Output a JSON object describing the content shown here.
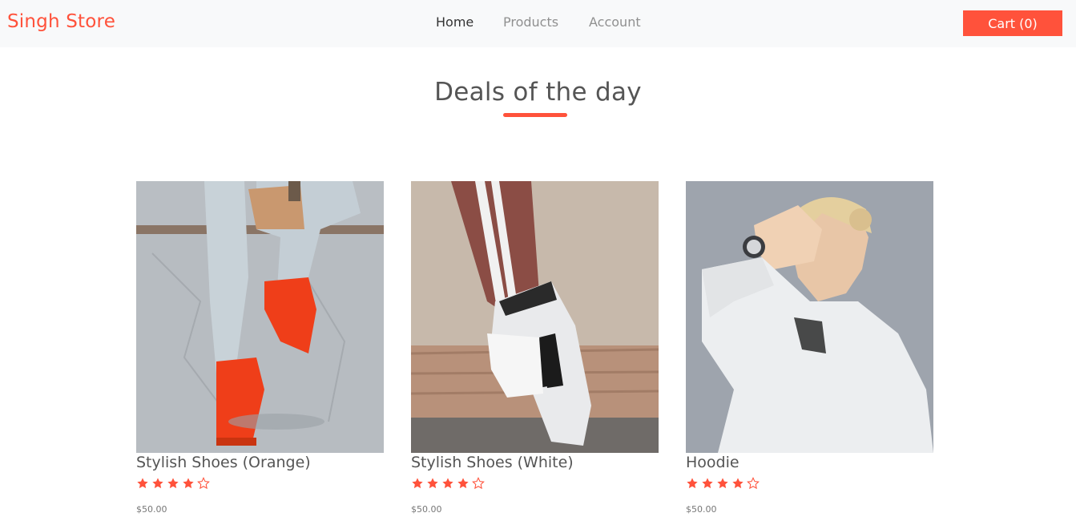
{
  "brand": {
    "name": "Singh Store"
  },
  "nav": {
    "links": [
      {
        "label": "Home",
        "active": true
      },
      {
        "label": "Products",
        "active": false
      },
      {
        "label": "Account",
        "active": false
      }
    ]
  },
  "cart": {
    "label": "Cart",
    "count": "(0)"
  },
  "section": {
    "title": "Deals of the day"
  },
  "products": [
    {
      "name": "Stylish Shoes (Orange)",
      "rating": 4,
      "max_rating": 5,
      "price": "$50.00"
    },
    {
      "name": "Stylish Shoes (White)",
      "rating": 4,
      "max_rating": 5,
      "price": "$50.00"
    },
    {
      "name": "Hoodie",
      "rating": 4,
      "max_rating": 5,
      "price": "$50.00"
    }
  ],
  "colors": {
    "accent": "#ff523b",
    "navbar_bg": "#f8f9fa",
    "text": "#555555"
  }
}
